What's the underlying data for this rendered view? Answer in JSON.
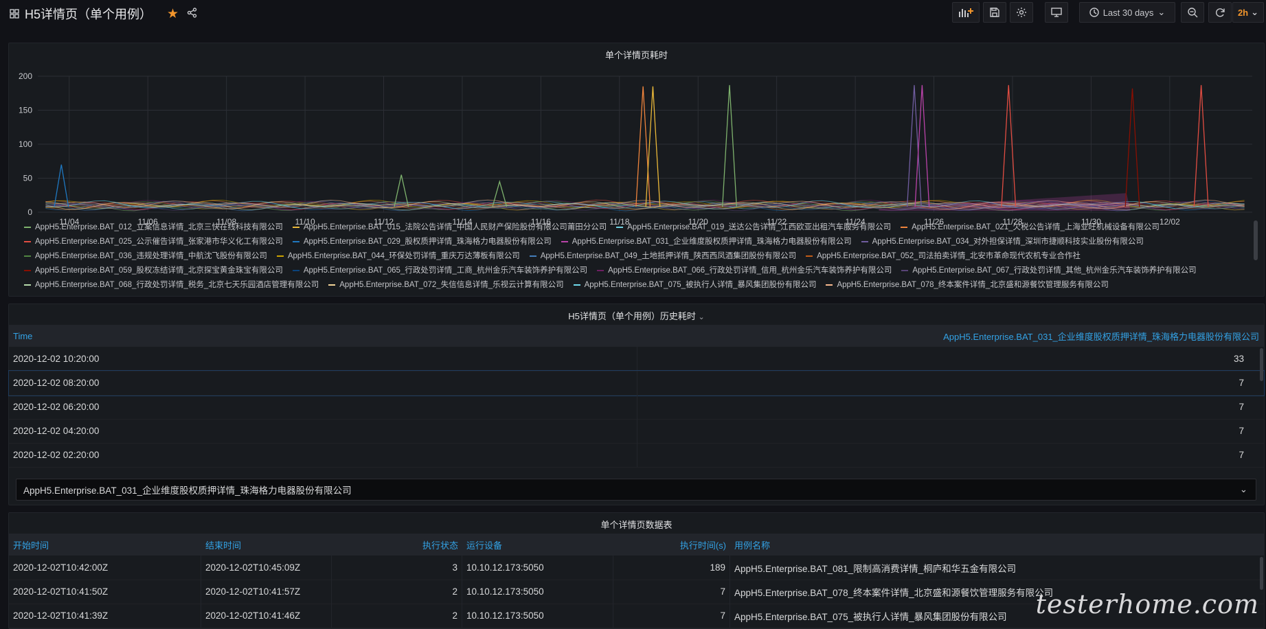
{
  "header": {
    "title": "H5详情页（单个用例）",
    "timepicker_label": "Last 30 days",
    "refresh_label": "2h"
  },
  "colors": {
    "accent": "#33a2e5",
    "star": "#f2952c",
    "refresh": "#f2952c"
  },
  "chart_panel": {
    "title": "单个详情页耗时",
    "legend": [
      {
        "label": "AppH5.Enterprise.BAT_012_立案信息详情_北京三快在线科技有限公司",
        "color": "#7eb26d"
      },
      {
        "label": "AppH5.Enterprise.BAT_015_法院公告详情_中国人民财产保险股份有限公司莆田分公司",
        "color": "#eab839"
      },
      {
        "label": "AppH5.Enterprise.BAT_019_送达公告详情_江西欧亚出租汽车服务有限公司",
        "color": "#6ed0e0"
      },
      {
        "label": "AppH5.Enterprise.BAT_021_欠税公告详情_上海业旺机械设备有限公司",
        "color": "#ef843c"
      },
      {
        "label": "AppH5.Enterprise.BAT_025_公示催告详情_张家港市华义化工有限公司",
        "color": "#e24d42"
      },
      {
        "label": "AppH5.Enterprise.BAT_029_股权质押详情_珠海格力电器股份有限公司",
        "color": "#1f78c1"
      },
      {
        "label": "AppH5.Enterprise.BAT_031_企业维度股权质押详情_珠海格力电器股份有限公司",
        "color": "#ba43a9"
      },
      {
        "label": "AppH5.Enterprise.BAT_034_对外担保详情_深圳市捷顺科技实业股份有限公司",
        "color": "#705da0"
      },
      {
        "label": "AppH5.Enterprise.BAT_036_违规处理详情_中航沈飞股份有限公司",
        "color": "#508642"
      },
      {
        "label": "AppH5.Enterprise.BAT_044_环保处罚详情_重庆万达薄板有限公司",
        "color": "#cca300"
      },
      {
        "label": "AppH5.Enterprise.BAT_049_土地抵押详情_陕西西凤酒集团股份有限公司",
        "color": "#447ebc"
      },
      {
        "label": "AppH5.Enterprise.BAT_052_司法拍卖详情_北安市革命现代农机专业合作社",
        "color": "#c15c17"
      },
      {
        "label": "AppH5.Enterprise.BAT_059_股权冻结详情_北京探宝黄金珠宝有限公司",
        "color": "#890f02"
      },
      {
        "label": "AppH5.Enterprise.BAT_065_行政处罚详情_工商_杭州金乐汽车装饰养护有限公司",
        "color": "#0a437c"
      },
      {
        "label": "AppH5.Enterprise.BAT_066_行政处罚详情_信用_杭州金乐汽车装饰养护有限公司",
        "color": "#6d1f62"
      },
      {
        "label": "AppH5.Enterprise.BAT_067_行政处罚详情_其他_杭州金乐汽车装饰养护有限公司",
        "color": "#584477"
      },
      {
        "label": "AppH5.Enterprise.BAT_068_行政处罚详情_税务_北京七天乐园酒店管理有限公司",
        "color": "#b7dbab"
      },
      {
        "label": "AppH5.Enterprise.BAT_072_失信信息详情_乐视云计算有限公司",
        "color": "#f4d598"
      },
      {
        "label": "AppH5.Enterprise.BAT_075_被执行人详情_暴风集团股份有限公司",
        "color": "#70dbed"
      },
      {
        "label": "AppH5.Enterprise.BAT_078_终本案件详情_北京盛和源餐饮管理服务有限公司",
        "color": "#f9ba8f"
      }
    ]
  },
  "chart_data": {
    "type": "line",
    "title": "单个详情页耗时",
    "xlabel": "",
    "ylabel": "",
    "ylim": [
      0,
      200
    ],
    "yticks": [
      "0",
      "50",
      "100",
      "150",
      "200"
    ],
    "xticks": [
      "11/04",
      "11/06",
      "11/08",
      "11/10",
      "11/12",
      "11/14",
      "11/16",
      "11/18",
      "11/20",
      "11/22",
      "11/24",
      "11/26",
      "11/28",
      "11/30",
      "12/02"
    ],
    "x_range_days": [
      11.2,
      12.02
    ],
    "grid": true,
    "legend_position": "bottom",
    "peaks": [
      {
        "day": 3.8,
        "value": 70,
        "color": "#1f78c1"
      },
      {
        "day": 12.45,
        "value": 55,
        "color": "#7eb26d"
      },
      {
        "day": 14.95,
        "value": 45,
        "color": "#7eb26d"
      },
      {
        "day": 18.6,
        "value": 185,
        "color": "#ef843c"
      },
      {
        "day": 18.85,
        "value": 185,
        "color": "#eab839"
      },
      {
        "day": 20.8,
        "value": 187,
        "color": "#7eb26d"
      },
      {
        "day": 25.5,
        "value": 187,
        "color": "#705da0"
      },
      {
        "day": 25.7,
        "value": 187,
        "color": "#ba43a9"
      },
      {
        "day": 27.9,
        "value": 187,
        "color": "#e24d42"
      },
      {
        "day": 31.05,
        "value": 182,
        "color": "#890f02"
      },
      {
        "day": 32.8,
        "value": 187,
        "color": "#e24d42"
      }
    ],
    "baseline_value": 8
  },
  "history_panel": {
    "title": "H5详情页（单个用例）历史耗时",
    "columns": [
      "Time",
      "AppH5.Enterprise.BAT_031_企业维度股权质押详情_珠海格力电器股份有限公司"
    ],
    "rows": [
      [
        "2020-12-02 10:20:00",
        "33"
      ],
      [
        "2020-12-02 08:20:00",
        "7"
      ],
      [
        "2020-12-02 06:20:00",
        "7"
      ],
      [
        "2020-12-02 04:20:00",
        "7"
      ],
      [
        "2020-12-02 02:20:00",
        "7"
      ]
    ],
    "select_value": "AppH5.Enterprise.BAT_031_企业维度股权质押详情_珠海格力电器股份有限公司"
  },
  "data_panel": {
    "title": "单个详情页数据表",
    "columns": [
      "开始时间",
      "结束时间",
      "执行状态",
      "运行设备",
      "执行时间(s)",
      "用例名称"
    ],
    "rows": [
      [
        "2020-12-02T10:42:00Z",
        "2020-12-02T10:45:09Z",
        "3",
        "10.10.12.173:5050",
        "189",
        "AppH5.Enterprise.BAT_081_限制高消费详情_桐庐和华五金有限公司"
      ],
      [
        "2020-12-02T10:41:50Z",
        "2020-12-02T10:41:57Z",
        "2",
        "10.10.12.173:5050",
        "7",
        "AppH5.Enterprise.BAT_078_终本案件详情_北京盛和源餐饮管理服务有限公司"
      ],
      [
        "2020-12-02T10:41:39Z",
        "2020-12-02T10:41:46Z",
        "2",
        "10.10.12.173:5050",
        "7",
        "AppH5.Enterprise.BAT_075_被执行人详情_暴风集团股份有限公司"
      ]
    ]
  },
  "watermark": "testerhome.com"
}
